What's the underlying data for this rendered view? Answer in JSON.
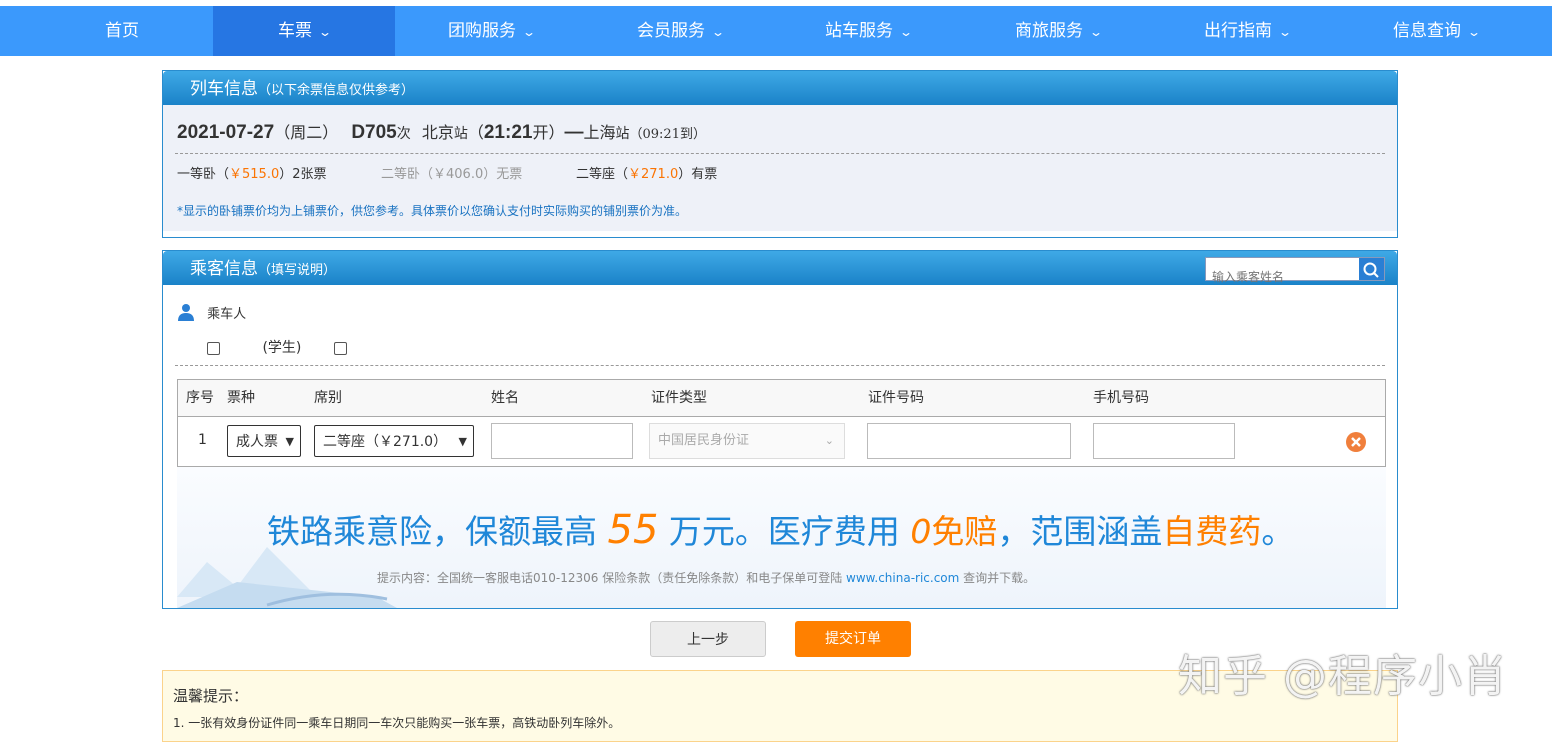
{
  "nav": {
    "items": [
      "首页",
      "车票",
      "团购服务",
      "会员服务",
      "站车服务",
      "商旅服务",
      "出行指南",
      "信息查询"
    ]
  },
  "train": {
    "title": "列车信息",
    "subtitle": "（以下余票信息仅供参考）",
    "date": "2021-07-27",
    "weekday": "（周二）",
    "train_no": "D705",
    "train_suffix": "次",
    "from_station": "北京",
    "station_suffix": "站",
    "depart_open": "（",
    "depart_time": "21:21",
    "depart_suffix": "开）",
    "dash": "—",
    "to_station": "上海",
    "arrive": "（09:21到）",
    "seats": [
      {
        "label": "一等卧（",
        "price": "￥515.0",
        "rest": "）2张票"
      },
      {
        "label": "二等卧（￥406.0）无票"
      },
      {
        "label": "二等座（",
        "price": "￥271.0",
        "rest": "）有票"
      }
    ],
    "note": "*显示的卧铺票价均为上铺票价，供您参考。具体票价以您确认支付时实际购买的铺别票价为准。"
  },
  "passenger": {
    "title": "乘客信息",
    "subtitle": "（填写说明）",
    "search_placeholder": "输入乘客姓名",
    "riders_label": "乘车人",
    "student_tag": "(学生)",
    "headers": [
      "序号",
      "票种",
      "席别",
      "姓名",
      "证件类型",
      "证件号码",
      "手机号码"
    ],
    "row": {
      "index": "1",
      "ticket_type": "成人票",
      "seat_type": "二等座（￥271.0）",
      "id_type": "中国居民身份证"
    }
  },
  "ad": {
    "part1": "铁路乘意险，保额最高 ",
    "num1": "55",
    "part2": " 万元",
    "dot1": "。",
    "part3": "医疗费用 ",
    "num2": "0",
    "part4": "免赔",
    "part5": "，范围涵盖",
    "part6": "自费药",
    "dot2": "。",
    "tip_prefix": "提示内容：全国统一客服电话010-12306 保险条款（责任免除条款）和电子保单可登陆 ",
    "tip_link": "www.china-ric.com",
    "tip_suffix": " 查询并下载。"
  },
  "buttons": {
    "prev": "上一步",
    "submit": "提交订单"
  },
  "warm": {
    "title": "温馨提示：",
    "line1": "1. 一张有效身份证件同一乘车日期同一车次只能购买一张车票，高铁动卧列车除外。"
  },
  "watermark": "知乎 @程序小肖",
  "colors": {
    "nav": "#3b99fc",
    "nav_active": "#2676e3",
    "price": "#fb7403",
    "submit": "#ff8000",
    "ad_blue": "#1f87d8"
  }
}
